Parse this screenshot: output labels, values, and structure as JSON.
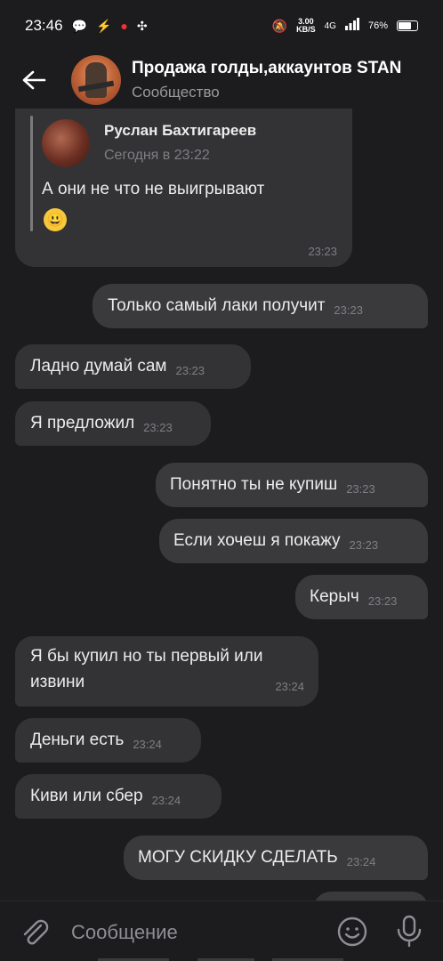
{
  "status": {
    "time": "23:46",
    "speed_value": "3.00",
    "speed_unit": "KB/S",
    "network": "4G",
    "battery": "76%",
    "battery_level": 0.76
  },
  "header": {
    "title": "Продажа голды,аккаунтов STAN",
    "subtitle": "Сообщество"
  },
  "quoted": {
    "author": "Руслан Бахтигареев",
    "date": "Сегодня в 23:22",
    "text": "А они не что не выигрывают",
    "emoji": "😃",
    "time": "23:23"
  },
  "messages": [
    {
      "dir": "out",
      "text": "Только самый лаки получит",
      "time": "23:23"
    },
    {
      "dir": "in",
      "text": "Ладно думай сам",
      "time": "23:23"
    },
    {
      "dir": "in",
      "text": "Я предложил",
      "time": "23:23"
    },
    {
      "dir": "out",
      "text": "Понятно ты не купиш",
      "time": "23:23"
    },
    {
      "dir": "out",
      "text": "Если хочеш я покажу",
      "time": "23:23"
    },
    {
      "dir": "out",
      "text": "Керыч",
      "time": "23:23"
    },
    {
      "dir": "in",
      "text": "Я бы купил но ты первый или извини",
      "time": "23:24"
    },
    {
      "dir": "in",
      "text": "Деньги есть",
      "time": "23:24"
    },
    {
      "dir": "in",
      "text": "Киви или сбер",
      "time": "23:24"
    },
    {
      "dir": "out",
      "text": "МОГУ СКИДКУ СДЕЛАТЬ",
      "time": "23:24"
    }
  ],
  "composer": {
    "placeholder": "Сообщение"
  },
  "icons": {
    "back": "arrow-left-icon",
    "attach": "paperclip-icon",
    "emoji": "smile-icon",
    "mic": "microphone-icon"
  }
}
